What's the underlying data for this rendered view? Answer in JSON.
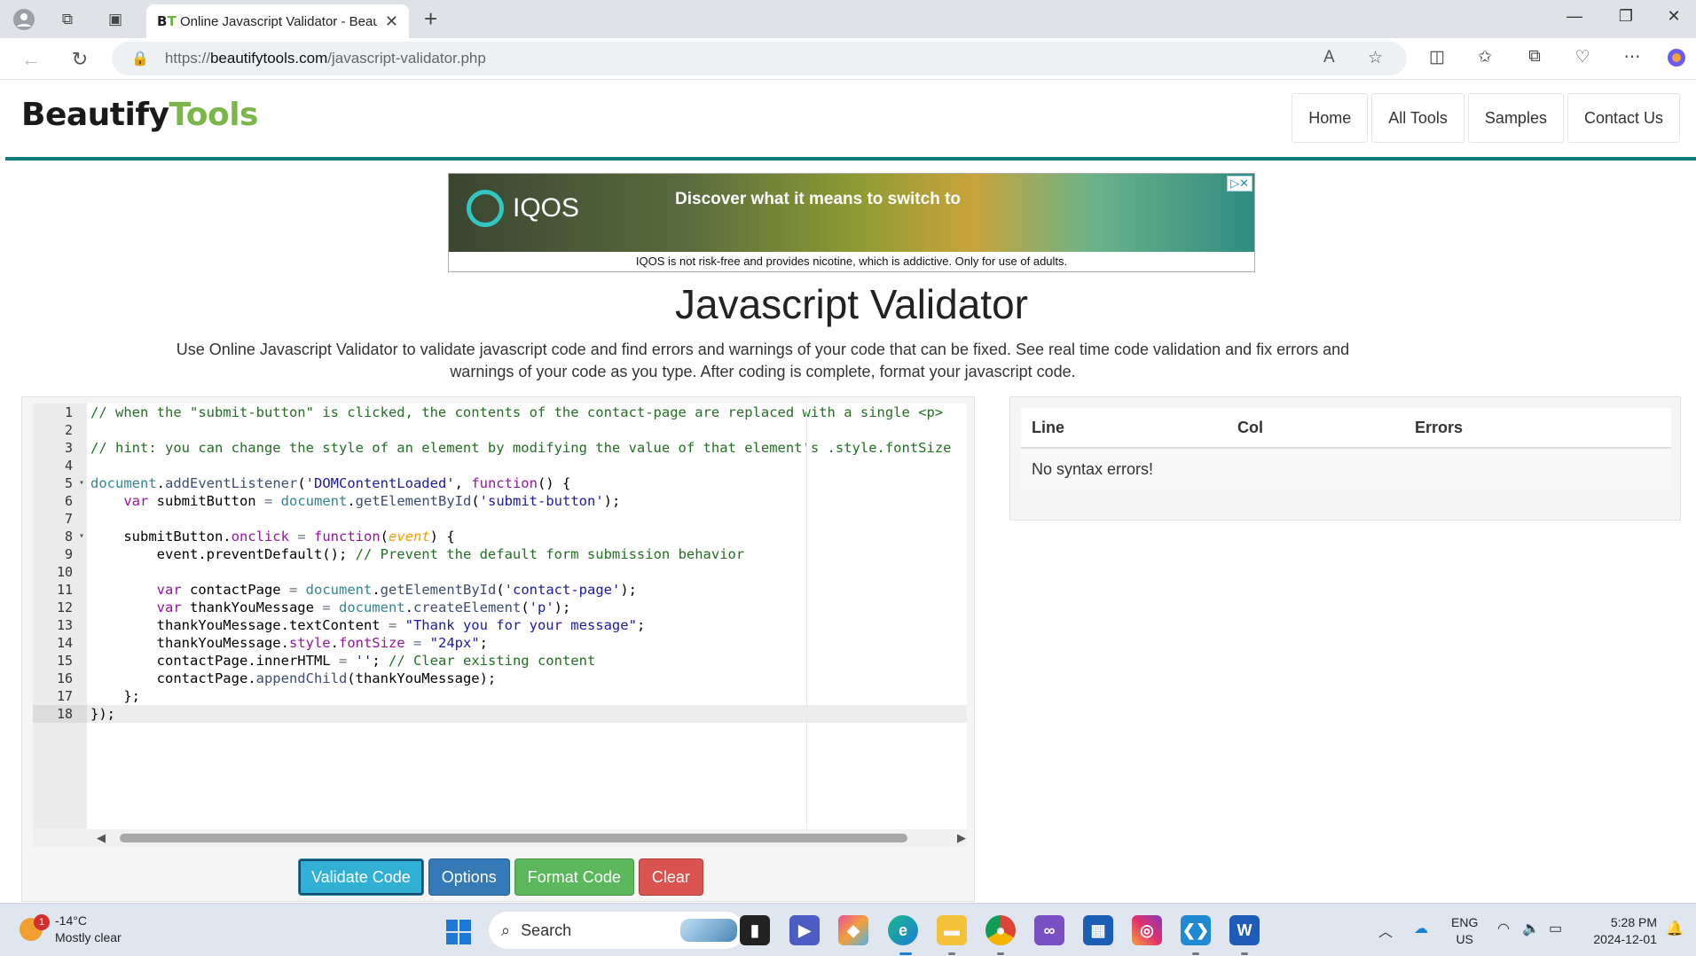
{
  "browser": {
    "tab_title": "Online Javascript Validator - Beau",
    "favicon_text": "BT",
    "url_prefix": "https://",
    "url_domain": "beautifytools.com",
    "url_path": "/javascript-validator.php"
  },
  "site": {
    "logo_part1": "Beautify",
    "logo_part2": "Tools",
    "nav": [
      "Home",
      "All Tools",
      "Samples",
      "Contact Us"
    ],
    "colors": {
      "accent_teal": "#0f7b7b",
      "logo_green": "#7ab648"
    }
  },
  "ad": {
    "brand": "IQOS",
    "headline": "Discover what it means to switch to",
    "disclaimer": "IQOS is not risk-free and provides nicotine, which is addictive. Only for use of adults.",
    "badge": "▷✕"
  },
  "page": {
    "title": "Javascript Validator",
    "description": "Use Online Javascript Validator to validate javascript code and find errors and warnings of your code that can be fixed. See real time code validation and fix errors and warnings of your code as you type. After coding is complete, format your javascript code."
  },
  "editor": {
    "line_numbers": [
      "1",
      "2",
      "3",
      "4",
      "5",
      "6",
      "7",
      "8",
      "9",
      "10",
      "11",
      "12",
      "13",
      "14",
      "15",
      "16",
      "17",
      "18"
    ],
    "lines": [
      "// when the \"submit-button\" is clicked, the contents of the contact-page are replaced with a single <p>",
      "",
      "// hint: you can change the style of an element by modifying the value of that element's .style.fontSize",
      "",
      "document.addEventListener('DOMContentLoaded', function() {",
      "    var submitButton = document.getElementById('submit-button');",
      "",
      "    submitButton.onclick = function(event) {",
      "        event.preventDefault(); // Prevent the default form submission behavior",
      "",
      "        var contactPage = document.getElementById('contact-page');",
      "        var thankYouMessage = document.createElement('p');",
      "        thankYouMessage.textContent = \"Thank you for your message\";",
      "        thankYouMessage.style.fontSize = \"24px\";",
      "        contactPage.innerHTML = ''; // Clear existing content",
      "        contactPage.appendChild(thankYouMessage);",
      "    };",
      "});"
    ],
    "buttons": {
      "validate": "Validate Code",
      "options": "Options",
      "format": "Format Code",
      "clear": "Clear"
    }
  },
  "results": {
    "columns": [
      "Line",
      "Col",
      "Errors"
    ],
    "message": "No syntax errors!"
  },
  "taskbar": {
    "weather_temp": "-14°C",
    "weather_desc": "Mostly clear",
    "weather_badge": "1",
    "search_label": "Search",
    "lang_1": "ENG",
    "lang_2": "US",
    "time": "5:28 PM",
    "date": "2024-12-01"
  }
}
